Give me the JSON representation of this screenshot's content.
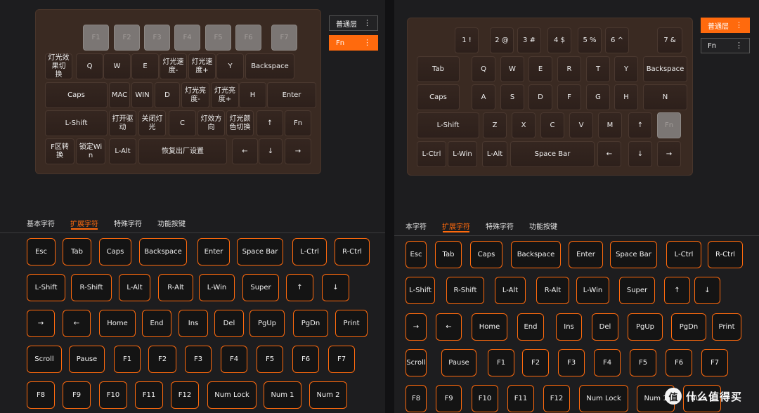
{
  "left": {
    "keyboard_rows": [
      [
        "F1",
        "F2",
        "F3",
        "F4",
        "F5",
        "F6",
        "F7"
      ],
      [
        "灯光效果切\n换",
        "Q",
        "W",
        "E",
        "灯光速\n度-",
        "灯光速\n度+",
        "Y",
        "Backspace"
      ],
      [
        "Caps",
        "MAC",
        "WIN",
        "D",
        "灯光亮\n度-",
        "灯光亮\n度+",
        "H",
        "Enter"
      ],
      [
        "L-Shift",
        "打开驱\n动",
        "关闭灯\n光",
        "C",
        "灯效方\n向",
        "灯光颜\n色切换",
        "↑",
        "Fn"
      ],
      [
        "F区转换",
        "锁定Wi\nn",
        "L-Alt",
        "恢复出厂设置",
        "←",
        "↓",
        "→"
      ]
    ],
    "layers": [
      {
        "label": "普通层",
        "menu": "⋮",
        "active": false
      },
      {
        "label": "Fn",
        "menu": "⋮",
        "active": true
      }
    ],
    "tabs": [
      "基本字符",
      "扩展字符",
      "特殊字符",
      "功能按键"
    ],
    "active_tab": "扩展字符"
  },
  "right": {
    "keyboard_rows": [
      [
        "1 !",
        "2 @",
        "3 #",
        "4 $",
        "5 %",
        "6 ^",
        "7 &"
      ],
      [
        "Tab",
        "Q",
        "W",
        "E",
        "R",
        "T",
        "Y",
        "Backspace"
      ],
      [
        "Caps",
        "A",
        "S",
        "D",
        "F",
        "G",
        "H",
        "N"
      ],
      [
        "L-Shift",
        "Z",
        "X",
        "C",
        "V",
        "M",
        "↑",
        "Fn"
      ],
      [
        "L-Ctrl",
        "L-Win",
        "L-Alt",
        "Space Bar",
        "←",
        "↓",
        "→"
      ]
    ],
    "layers": [
      {
        "label": "普通层",
        "menu": "⋮",
        "active": true
      },
      {
        "label": "Fn",
        "menu": "⋮",
        "active": false
      }
    ],
    "tabs": [
      "本字符",
      "扩展字符",
      "特殊字符",
      "功能按键"
    ],
    "active_tab": "扩展字符"
  },
  "char_rows": [
    [
      "Esc",
      "Tab",
      "Caps",
      "Backspace",
      "Enter",
      "Space Bar",
      "L-Ctrl",
      "R-Ctrl"
    ],
    [
      "L-Shift",
      "R-Shift",
      "L-Alt",
      "R-Alt",
      "L-Win",
      "Super",
      "↑",
      "↓"
    ],
    [
      "→",
      "←",
      "Home",
      "End",
      "Ins",
      "Del",
      "PgUp",
      "PgDn",
      "Print"
    ],
    [
      "Scroll",
      "Pause",
      "F1",
      "F2",
      "F3",
      "F4",
      "F5",
      "F6",
      "F7"
    ],
    [
      "F8",
      "F9",
      "F10",
      "F11",
      "F12",
      "Num Lock",
      "Num 1",
      "Num 2"
    ]
  ],
  "watermark": {
    "logo": "值",
    "text": "什么值得买"
  },
  "colors": {
    "accent": "#ff6a0d",
    "keyboard_bg": "#3a2a22",
    "page_bg": "#1d1d1f"
  }
}
